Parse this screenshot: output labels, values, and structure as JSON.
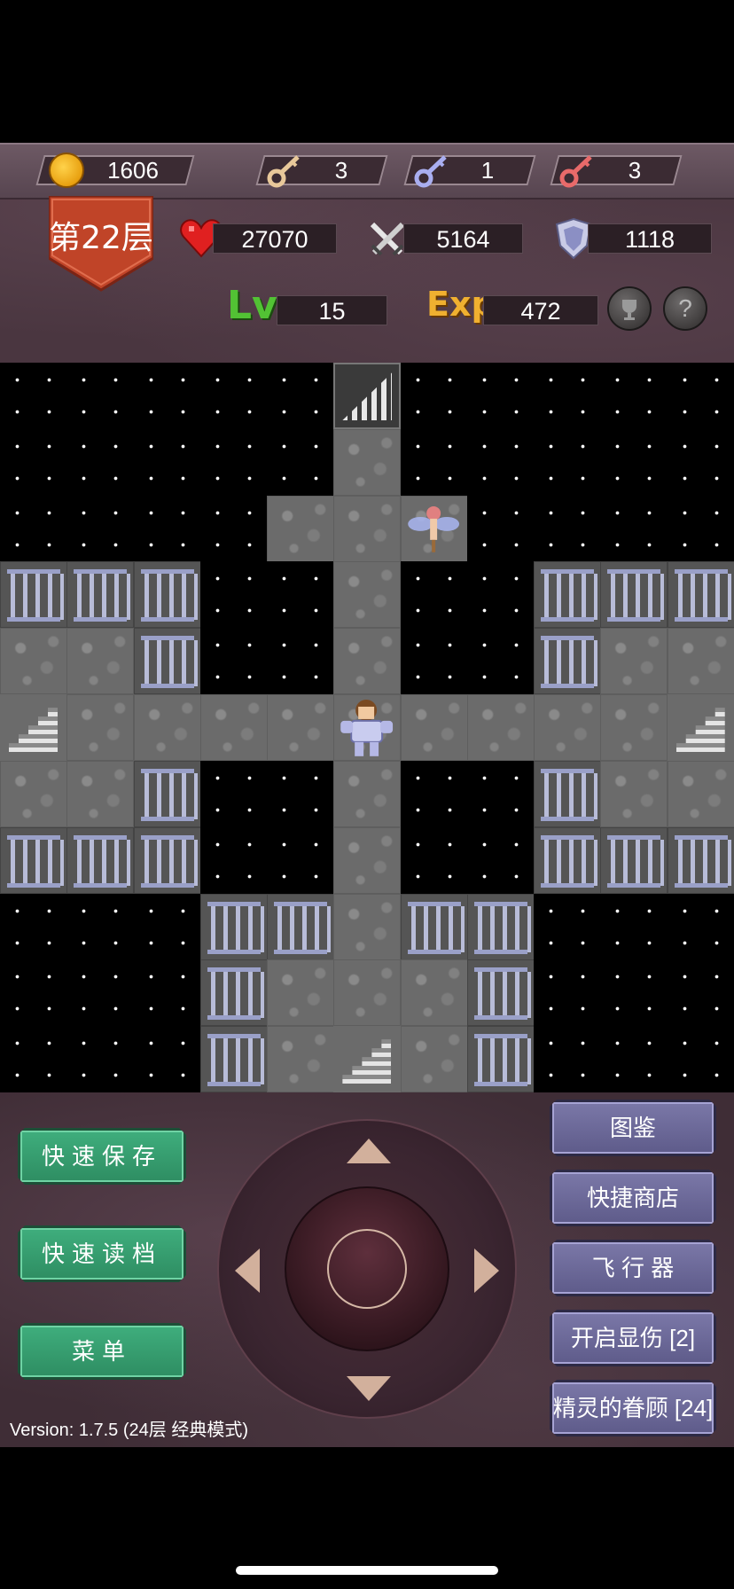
{
  "hud": {
    "gold": "1606",
    "yellow_keys": "3",
    "blue_keys": "1",
    "red_keys": "3",
    "floor": "第22层",
    "hp": "27070",
    "attack": "5164",
    "defense": "1118",
    "lv_label": "Lv",
    "level": "15",
    "exp_label": "Exp",
    "exp": "472",
    "help_symbol": "?"
  },
  "colors": {
    "hp_red": "#e02020",
    "lv_green": "#52c234",
    "exp_gold": "#f0b030"
  },
  "map": {
    "cols": 11,
    "rows": 11,
    "grid": [
      "SSSSSUSSSSS",
      "SSSSSFSSSSS",
      "SSSSFFFSSSS",
      "WWWSSFSSWWW",
      "FFWSSFSSWFF",
      "DFFFFFFFFFD",
      "FFWSSFSSWFF",
      "WWWSSFSSWWW",
      "SSSWWFWWSSS",
      "SSSWFFFWSSS",
      "SSSWFDFWSSS"
    ],
    "legend": {
      "S": "starfield",
      "F": "stone-floor",
      "W": "iron-bars",
      "D": "stairs-down",
      "U": "stairs-up"
    },
    "hero": {
      "col": 5,
      "row": 5,
      "icon": "armored-hero"
    },
    "monsters": [
      {
        "col": 6,
        "row": 2,
        "icon": "fairy"
      }
    ]
  },
  "controls": {
    "quick_save": "快速保存",
    "quick_load": "快速读档",
    "menu": "菜单",
    "bestiary": "图鉴",
    "quick_shop": "快捷商店",
    "fly": "飞 行 器",
    "show_damage": "开启显伤 [2]",
    "fairy_favor": "精灵的眷顾 [24]",
    "version": "Version: 1.7.5 (24层 经典模式)"
  }
}
